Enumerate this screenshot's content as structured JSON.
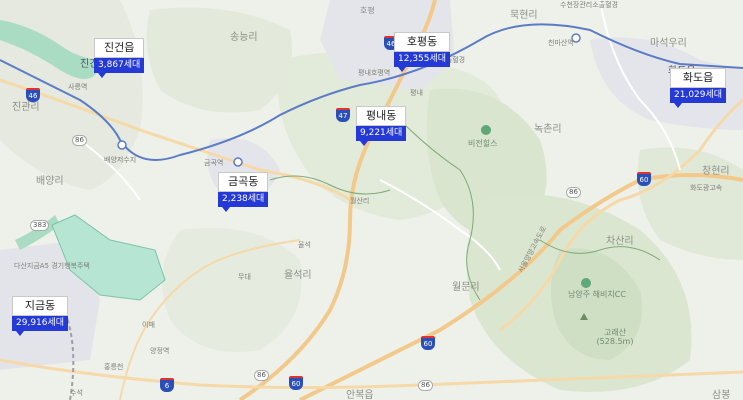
{
  "places": [
    {
      "label": "송능리"
    },
    {
      "label": "호평"
    },
    {
      "label": "묵현리"
    },
    {
      "label": "수천장관리소출혈경"
    },
    {
      "label": "천마산역"
    },
    {
      "label": "마석우리"
    },
    {
      "label": "화도읍"
    },
    {
      "label": "진건읍"
    },
    {
      "label": "사릉역"
    },
    {
      "label": "진관리"
    },
    {
      "label": "평내호평역"
    },
    {
      "label": "마치고개출혈경"
    },
    {
      "label": "평내"
    },
    {
      "label": "녹촌리"
    },
    {
      "label": "비전힐스"
    },
    {
      "label": "창현리"
    },
    {
      "label": "배양저수지"
    },
    {
      "label": "금곡역"
    },
    {
      "label": "배양리"
    },
    {
      "label": "월산리"
    },
    {
      "label": "차산리"
    },
    {
      "label": "율석"
    },
    {
      "label": "율석리"
    },
    {
      "label": "월문리"
    },
    {
      "label": "서울양양고속도로"
    },
    {
      "label": "무대"
    },
    {
      "label": "다산지금A5 경기행복주택"
    },
    {
      "label": "남양주 해비치CC"
    },
    {
      "label": "고래산 (528.5m)"
    },
    {
      "label": "이패"
    },
    {
      "label": "양정역"
    },
    {
      "label": "홍릉천"
    },
    {
      "label": "수석"
    },
    {
      "label": "안복읍"
    },
    {
      "label": "삼봉"
    },
    {
      "label": "화도광고속"
    }
  ],
  "route_shields": [
    "46",
    "46",
    "86",
    "86",
    "86",
    "86",
    "60",
    "60",
    "60",
    "6",
    "383",
    "47"
  ],
  "markers": [
    {
      "id": "jingeon",
      "name": "진건읍",
      "count": "3,867세대"
    },
    {
      "id": "hopyeong",
      "name": "호평동",
      "count": "12,355세대"
    },
    {
      "id": "hwado",
      "name": "화도읍",
      "count": "21,029세대"
    },
    {
      "id": "pyeongnae",
      "name": "평내동",
      "count": "9,221세대"
    },
    {
      "id": "geumgok",
      "name": "금곡동",
      "count": "2,238세대"
    },
    {
      "id": "jigeum",
      "name": "지금동",
      "count": "29,916세대"
    }
  ],
  "colors": {
    "background": "#eef0ea",
    "forest": "#dfe8d6",
    "water": "#a9dcc2",
    "urban": "#dfe1e6",
    "highway": "#f2c98a",
    "rail": "#5b7cc4",
    "marker_count_bg": "#2439d6",
    "marker_name_bg": "#ffffff"
  }
}
